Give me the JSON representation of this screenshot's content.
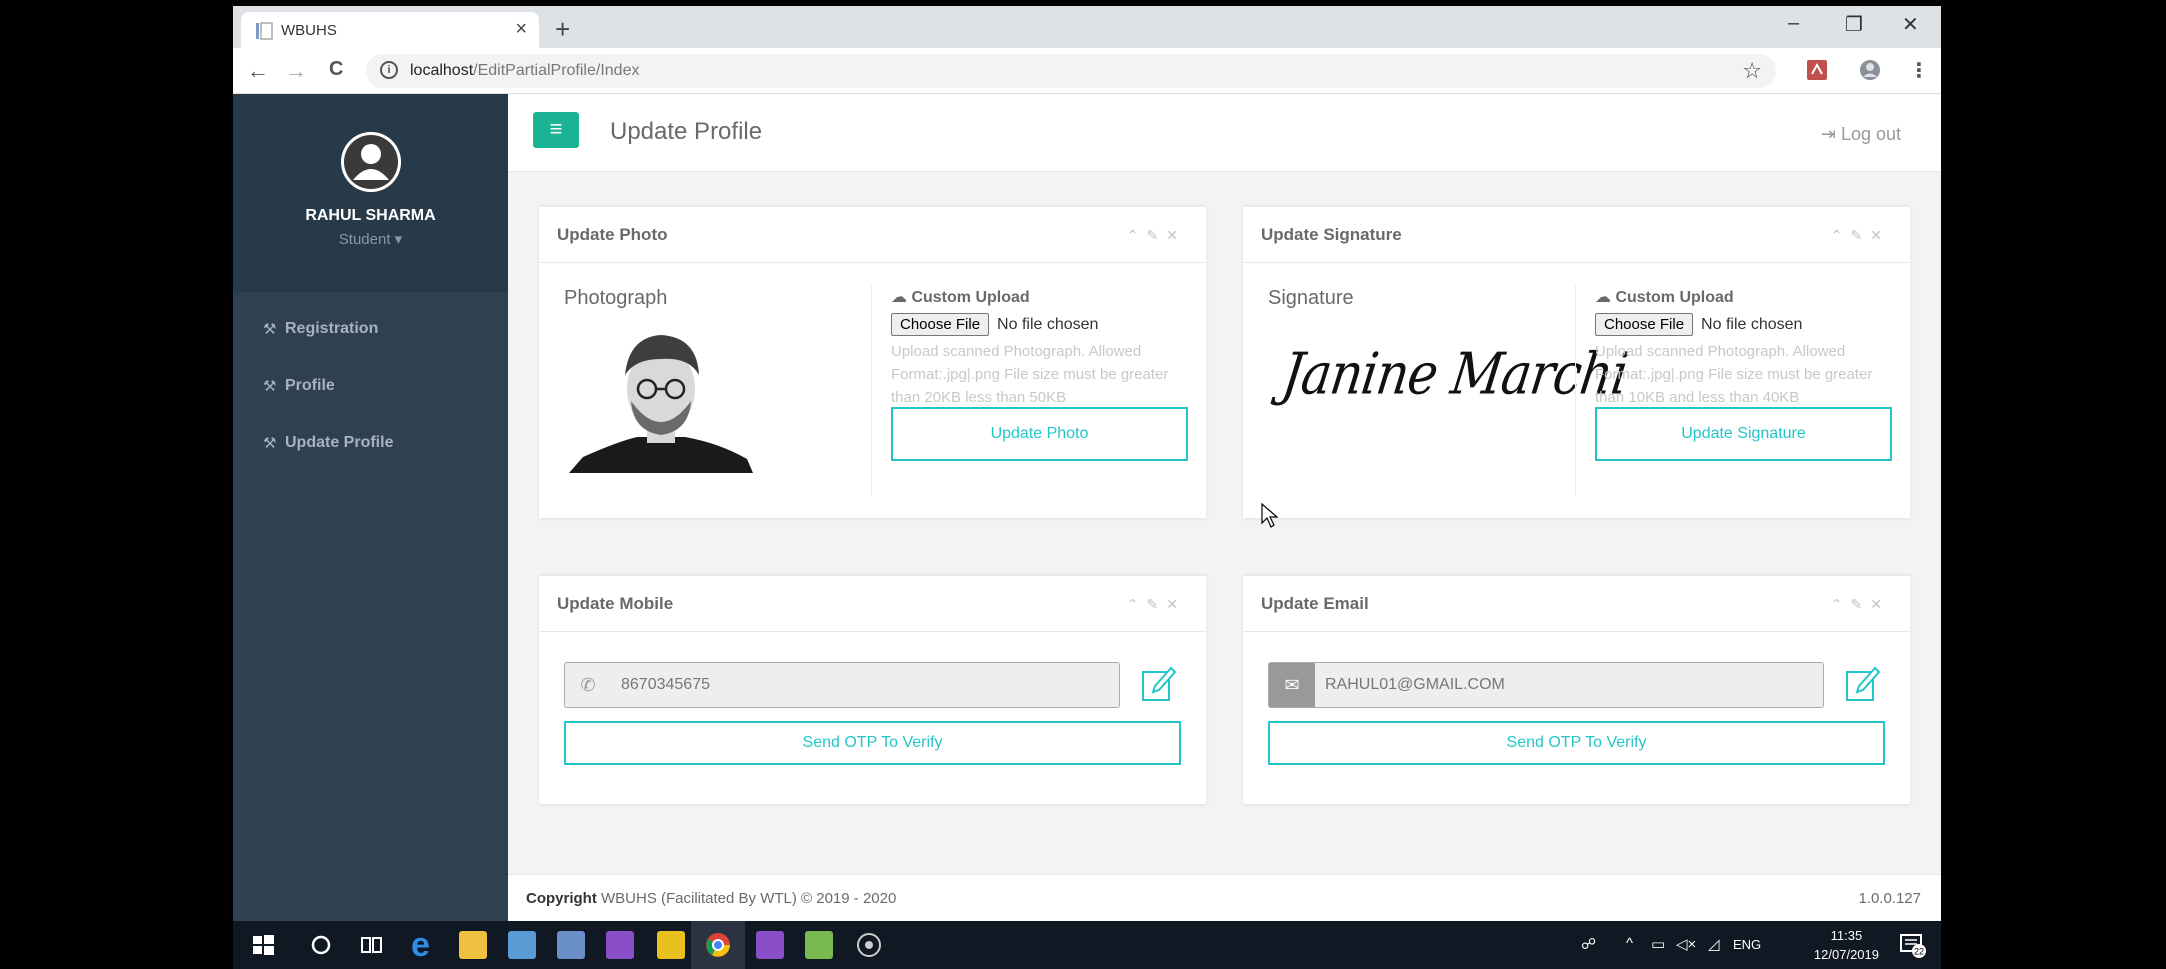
{
  "browser": {
    "tab_title": "WBUHS",
    "tab_close": "×",
    "new_tab": "+",
    "win_minimize": "–",
    "win_restore": "❐",
    "win_close": "✕",
    "back": "←",
    "forward": "→",
    "reload": "C",
    "url_host": "localhost",
    "url_path": "/EditPartialProfile/Index",
    "star": "☆"
  },
  "sidebar": {
    "user_name": "RAHUL SHARMA",
    "user_role": "Student ▾",
    "items": [
      {
        "label": "Registration"
      },
      {
        "label": "Profile"
      },
      {
        "label": "Update Profile"
      }
    ]
  },
  "header": {
    "title": "Update Profile",
    "logout": "Log out"
  },
  "photo_panel": {
    "title": "Update Photo",
    "label": "Photograph",
    "upload_title": "Custom Upload",
    "choose": "Choose File",
    "no_file": "No file chosen",
    "help": "Upload scanned Photograph. Allowed Format:.jpg|.png File size must be greater than 20KB less than 50KB",
    "button": "Update Photo"
  },
  "signature_panel": {
    "title": "Update Signature",
    "label": "Signature",
    "signature_text": "Janine Marchi",
    "upload_title": "Custom Upload",
    "choose": "Choose File",
    "no_file": "No file chosen",
    "help": "Upload scanned Photograph. Allowed Format:.jpg|.png File size must be greater than 10KB and less than 40KB",
    "button": "Update Signature"
  },
  "mobile_panel": {
    "title": "Update Mobile",
    "value": "8670345675",
    "button": "Send OTP To Verify"
  },
  "email_panel": {
    "title": "Update Email",
    "value": "RAHUL01@GMAIL.COM",
    "button": "Send OTP To Verify"
  },
  "footer": {
    "copyright_label": "Copyright",
    "copyright_text": "WBUHS (Facilitated By WTL) © 2019 - 2020",
    "version": "1.0.0.127"
  },
  "taskbar": {
    "language": "ENG",
    "time": "11:35",
    "date": "12/07/2019",
    "notification_count": "22"
  },
  "colors": {
    "accent": "#1ab394",
    "info": "#23c6c8",
    "sidebar": "#2f4050"
  }
}
